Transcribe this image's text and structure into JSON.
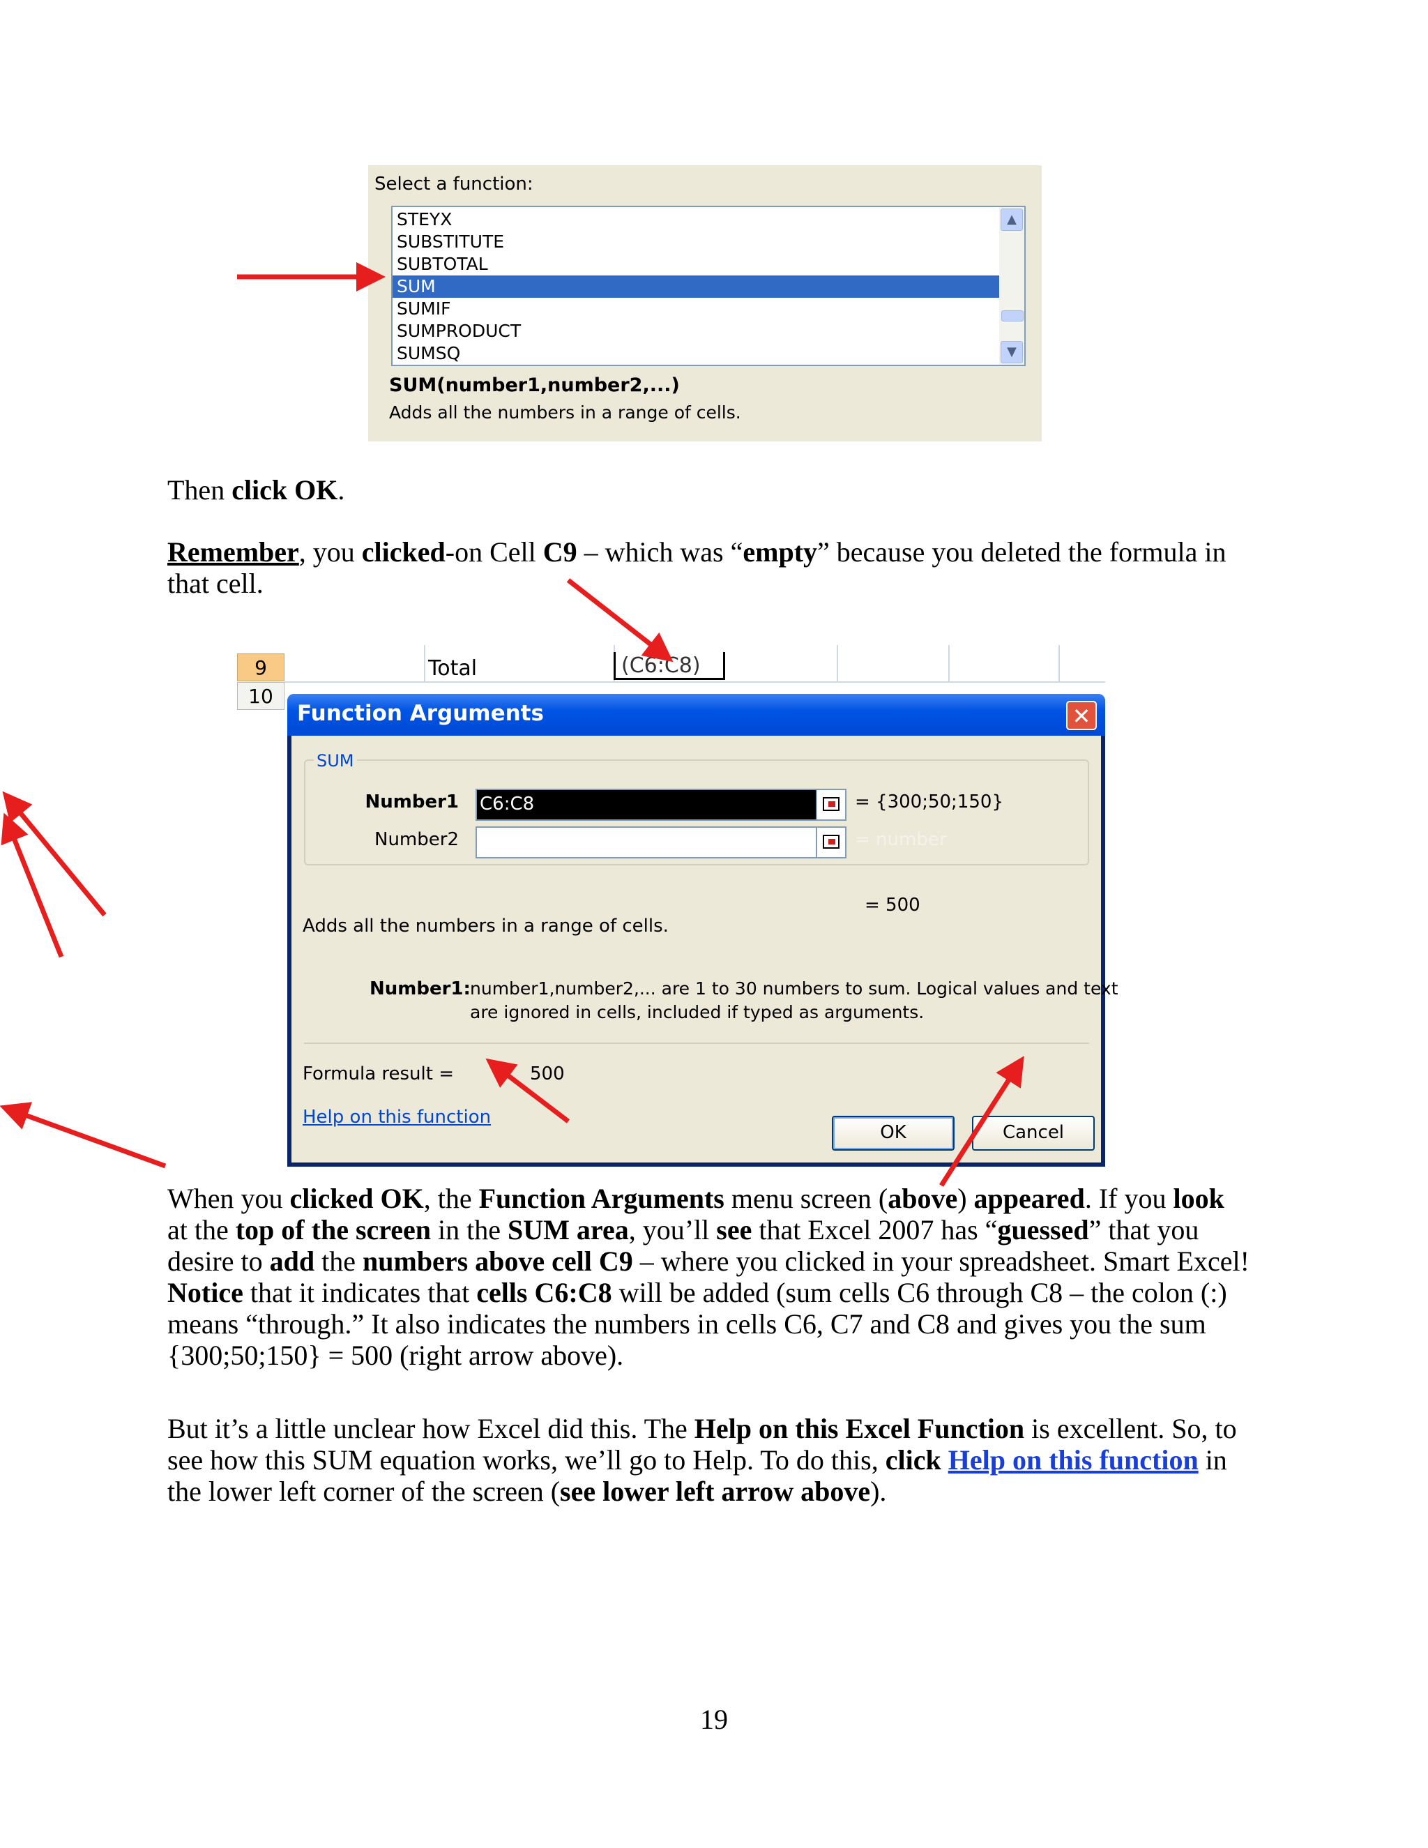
{
  "fn_panel": {
    "label": "Select a function:",
    "items": [
      "STEYX",
      "SUBSTITUTE",
      "SUBTOTAL",
      "SUM",
      "SUMIF",
      "SUMPRODUCT",
      "SUMSQ"
    ],
    "selected_index": 3,
    "signature": "SUM(number1,number2,...)",
    "description": "Adds all the numbers in a range of cells.",
    "scroll_up": "▲",
    "scroll_down": "▼"
  },
  "para1": {
    "pre": "Then ",
    "bold": "click OK",
    "post": "."
  },
  "para2": {
    "l1a": "Remember",
    "l1b": ", you ",
    "l1c": "clicked",
    "l1d": "-on Cell ",
    "l1e": "C9",
    "l1f": " – which was “",
    "l1g": "empty",
    "l1h": "” because you deleted the formula in",
    "l2": "that cell."
  },
  "sheet": {
    "row9": "9",
    "row10": "10",
    "total": "Total",
    "cell": "(C6:C8)"
  },
  "dialog": {
    "title": "Function Arguments",
    "close": "✕",
    "group": "SUM",
    "number1_label": "Number1",
    "number1_value": "C6:C8",
    "number1_result": "= {300;50;150}",
    "number2_label": "Number2",
    "number2_result": "= number",
    "total_result": "= 500",
    "description": "Adds all the numbers in a range of cells.",
    "help_label": "Number1:",
    "help_l1": "number1,number2,... are 1 to 30 numbers to sum. Logical values and text",
    "help_l2": "are ignored in cells, included if typed as arguments.",
    "formula_label": "Formula result =",
    "formula_value": "500",
    "help_link": "Help on this function",
    "ok": "OK",
    "cancel": "Cancel"
  },
  "para3": {
    "l1a": "When you ",
    "l1b": "clicked OK",
    "l1c": ", the ",
    "l1d": "Function Arguments",
    "l1e": " menu screen (",
    "l1f": "above",
    "l1g": ") ",
    "l1h": "appeared",
    "l1i": ".  If you ",
    "l1j": "look",
    "l2a": "at the ",
    "l2b": "top of the screen",
    "l2c": " in the ",
    "l2d": "SUM area",
    "l2e": ", you’ll ",
    "l2f": "see",
    "l2g": " that Excel 2007 has “",
    "l2h": "guessed",
    "l2i": "” that you",
    "l3a": "desire to ",
    "l3b": "add",
    "l3c": " the ",
    "l3d": "numbers above cell C9",
    "l3e": " – where you clicked in your spreadsheet.  Smart Excel!",
    "l4a": "Notice",
    "l4b": " that it indicates that ",
    "l4c": "cells C6:C8",
    "l4d": " will be added (sum cells C6 through C8 – the colon (:)",
    "l5": "means “through.”  It also indicates the numbers in cells C6, C7 and C8 and gives you the sum",
    "l6": "{300;50;150} = 500 (right arrow above)."
  },
  "para4": {
    "l1a": "But it’s a little unclear how Excel did this.  The ",
    "l1b": "Help on this Excel Function",
    "l1c": " is excellent.  So, to",
    "l2a": "see how this SUM equation works, we’ll go to Help.  To do this, ",
    "l2b": "click",
    "l2c": "Help on this function",
    "l2d": " in",
    "l3a": "the lower left corner of the screen (",
    "l3b": "see lower left arrow above",
    "l3c": ")."
  },
  "page_number": "19",
  "colors": {
    "arrow": "#e61e1e",
    "selection": "#316ac5",
    "title_bar": "#0054e3",
    "link": "#1a3fd6"
  }
}
